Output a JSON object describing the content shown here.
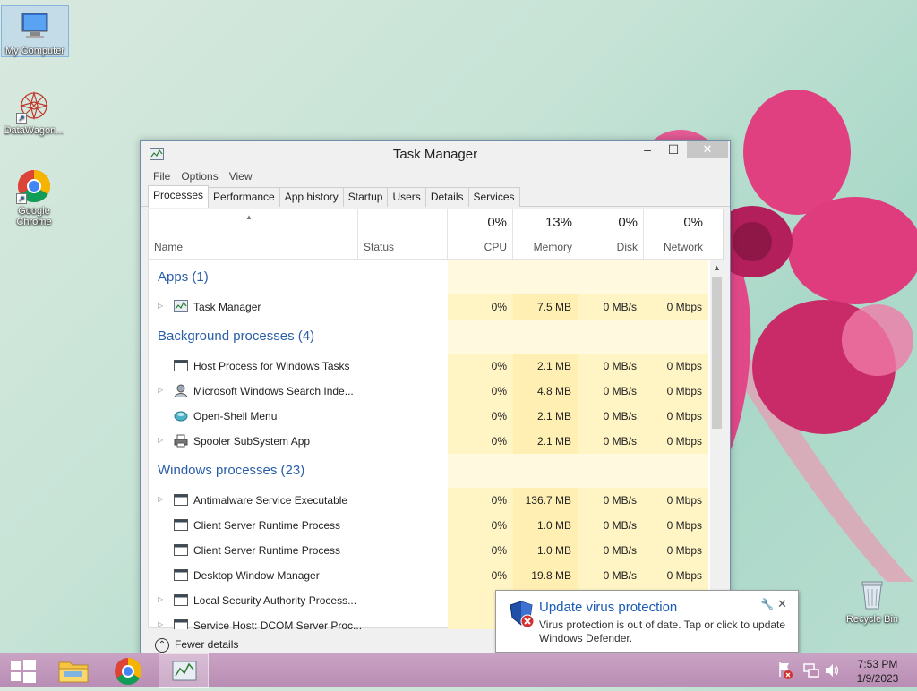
{
  "desktop": {
    "icons": [
      {
        "label": "My Computer"
      },
      {
        "label": "DataWagon..."
      },
      {
        "label": "Google Chrome"
      },
      {
        "label": "Recycle Bin"
      }
    ]
  },
  "window": {
    "title": "Task Manager",
    "menu": [
      "File",
      "Options",
      "View"
    ],
    "tabs": [
      "Processes",
      "Performance",
      "App history",
      "Startup",
      "Users",
      "Details",
      "Services"
    ],
    "active_tab": "Processes",
    "columns": {
      "name": "Name",
      "status": "Status",
      "cpu": {
        "pct": "0%",
        "label": "CPU"
      },
      "memory": {
        "pct": "13%",
        "label": "Memory"
      },
      "disk": {
        "pct": "0%",
        "label": "Disk"
      },
      "network": {
        "pct": "0%",
        "label": "Network"
      }
    },
    "groups": [
      {
        "title": "Apps (1)",
        "rows": [
          {
            "name": "Task Manager",
            "icon": "task-manager-icon",
            "expandable": true,
            "cpu": "0%",
            "memory": "7.5 MB",
            "disk": "0 MB/s",
            "network": "0 Mbps"
          }
        ]
      },
      {
        "title": "Background processes (4)",
        "rows": [
          {
            "name": "Host Process for Windows Tasks",
            "icon": "window-process-icon",
            "expandable": false,
            "cpu": "0%",
            "memory": "2.1 MB",
            "disk": "0 MB/s",
            "network": "0 Mbps"
          },
          {
            "name": "Microsoft Windows Search Inde...",
            "icon": "search-user-icon",
            "expandable": true,
            "cpu": "0%",
            "memory": "4.8 MB",
            "disk": "0 MB/s",
            "network": "0 Mbps"
          },
          {
            "name": "Open-Shell Menu",
            "icon": "shell-icon",
            "expandable": false,
            "cpu": "0%",
            "memory": "2.1 MB",
            "disk": "0 MB/s",
            "network": "0 Mbps"
          },
          {
            "name": "Spooler SubSystem App",
            "icon": "printer-icon",
            "expandable": true,
            "cpu": "0%",
            "memory": "2.1 MB",
            "disk": "0 MB/s",
            "network": "0 Mbps"
          }
        ]
      },
      {
        "title": "Windows processes (23)",
        "rows": [
          {
            "name": "Antimalware Service Executable",
            "icon": "window-process-icon",
            "expandable": true,
            "cpu": "0%",
            "memory": "136.7 MB",
            "disk": "0 MB/s",
            "network": "0 Mbps"
          },
          {
            "name": "Client Server Runtime Process",
            "icon": "window-process-icon",
            "expandable": false,
            "cpu": "0%",
            "memory": "1.0 MB",
            "disk": "0 MB/s",
            "network": "0 Mbps"
          },
          {
            "name": "Client Server Runtime Process",
            "icon": "window-process-icon",
            "expandable": false,
            "cpu": "0%",
            "memory": "1.0 MB",
            "disk": "0 MB/s",
            "network": "0 Mbps"
          },
          {
            "name": "Desktop Window Manager",
            "icon": "window-process-icon",
            "expandable": false,
            "cpu": "0%",
            "memory": "19.8 MB",
            "disk": "0 MB/s",
            "network": "0 Mbps"
          },
          {
            "name": "Local Security Authority Process...",
            "icon": "window-process-icon",
            "expandable": true,
            "cpu": "0",
            "memory": "",
            "disk": "",
            "network": ""
          },
          {
            "name": "Service Host: DCOM Server Proc...",
            "icon": "window-process-icon",
            "expandable": true,
            "cpu": "0",
            "memory": "",
            "disk": "",
            "network": ""
          }
        ]
      }
    ],
    "fewer_details": "Fewer details"
  },
  "notification": {
    "title": "Update virus protection",
    "text": "Virus protection is out of date. Tap or click to update Windows Defender."
  },
  "taskbar": {
    "time": "7:53 PM",
    "date": "1/9/2023"
  },
  "colors": {
    "accent": "#2a5ea8",
    "heat_light": "#fff4c4",
    "heat_medium": "#ffefb2",
    "taskbar": "#c09abb"
  }
}
